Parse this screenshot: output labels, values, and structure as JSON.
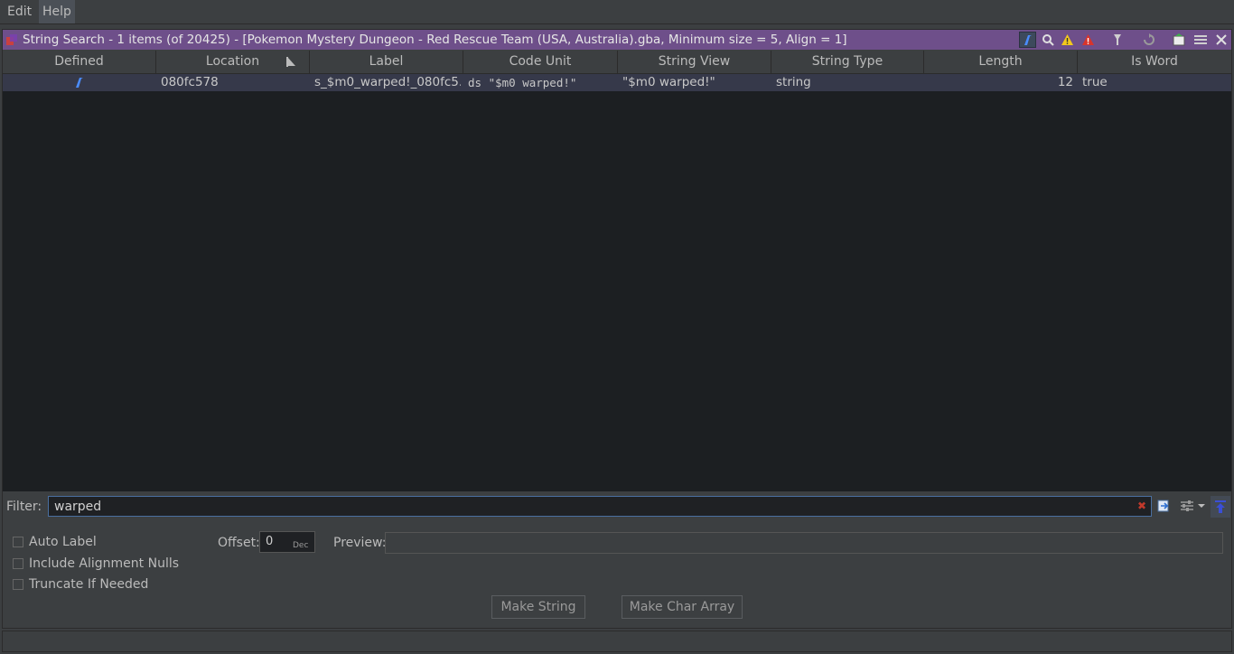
{
  "menu": {
    "items": [
      "Edit",
      "Help"
    ]
  },
  "window": {
    "title": "String Search - 1 items (of 20425) - [Pokemon Mystery Dungeon - Red Rescue Team (USA, Australia).gba, Minimum size = 5, Align = 1]"
  },
  "table": {
    "columns": [
      "Defined",
      "Location",
      "Label",
      "Code Unit",
      "String View",
      "String Type",
      "Length",
      "Is Word"
    ],
    "rows": [
      {
        "location": "080fc578",
        "label": "s_$m0_warped!_080fc5...",
        "code_unit": "ds \"$m0 warped!\"",
        "string_view": "\"$m0 warped!\"",
        "string_type": "string",
        "length": "12",
        "is_word": "true"
      }
    ]
  },
  "filter": {
    "label": "Filter:",
    "value": "warped"
  },
  "options": {
    "auto_label": "Auto Label",
    "include_alignment_nulls": "Include Alignment Nulls",
    "truncate_if_needed": "Truncate If Needed",
    "offset_label": "Offset:",
    "offset_value": "0",
    "offset_unit": "Dec",
    "preview_label": "Preview:",
    "preview_value": ""
  },
  "buttons": {
    "make_string": "Make String",
    "make_char_array": "Make Char Array"
  },
  "colors": {
    "title_bar": "#6e4f8a",
    "selected_row": "#36394a",
    "table_bg": "#1c1f22",
    "accent_blue": "#4a8cff",
    "warning_yellow": "#f2c81c",
    "error_red": "#d9342b"
  }
}
